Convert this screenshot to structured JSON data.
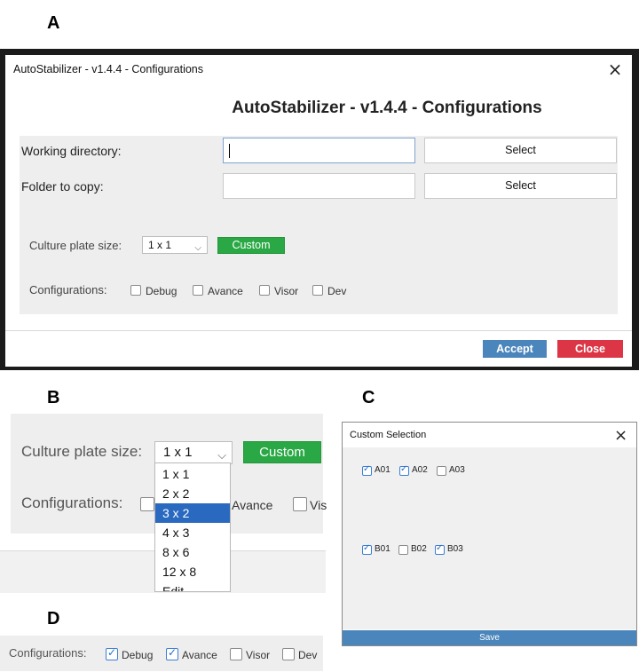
{
  "panels": {
    "a": "A",
    "b": "B",
    "c": "C",
    "d": "D"
  },
  "panel_a": {
    "window_title": "AutoStabilizer - v1.4.4 - Configurations",
    "heading": "AutoStabilizer - v1.4.4 - Configurations",
    "working_directory_label": "Working directory:",
    "working_directory_value": "",
    "folder_to_copy_label": "Folder to copy:",
    "folder_to_copy_value": "",
    "select_label": "Select",
    "culture_plate_label": "Culture plate size:",
    "culture_plate_value": "1 x 1",
    "custom_label": "Custom",
    "configurations_label": "Configurations:",
    "checkboxes": [
      {
        "label": "Debug",
        "checked": false
      },
      {
        "label": "Avance",
        "checked": false
      },
      {
        "label": "Visor",
        "checked": false
      },
      {
        "label": "Dev",
        "checked": false
      }
    ],
    "accept_label": "Accept",
    "close_label": "Close",
    "colors": {
      "accept": "#4a85bb",
      "close": "#dc3545",
      "custom": "#2aa845"
    }
  },
  "panel_b": {
    "culture_plate_label": "Culture plate size:",
    "culture_plate_value": "1 x 1",
    "custom_label": "Custom",
    "configurations_label": "Configurations:",
    "options": [
      "1 x 1",
      "2 x 2",
      "3 x 2",
      "4 x 3",
      "8 x 6",
      "12 x 8",
      "Edit"
    ],
    "highlighted_option": "3 x 2",
    "visible_partial_labels": [
      "Avance",
      "Vis"
    ]
  },
  "panel_c": {
    "window_title": "Custom Selection",
    "row1": [
      {
        "label": "A01",
        "checked": true
      },
      {
        "label": "A02",
        "checked": true
      },
      {
        "label": "A03",
        "checked": false
      }
    ],
    "row2": [
      {
        "label": "B01",
        "checked": true
      },
      {
        "label": "B02",
        "checked": false
      },
      {
        "label": "B03",
        "checked": true
      }
    ],
    "save_label": "Save"
  },
  "panel_d": {
    "configurations_label": "Configurations:",
    "checkboxes": [
      {
        "label": "Debug",
        "checked": true
      },
      {
        "label": "Avance",
        "checked": true
      },
      {
        "label": "Visor",
        "checked": false
      },
      {
        "label": "Dev",
        "checked": false
      }
    ]
  },
  "icons": {
    "close": "close-icon",
    "chevron": "chevron-down-icon",
    "check": "checkmark-icon"
  }
}
